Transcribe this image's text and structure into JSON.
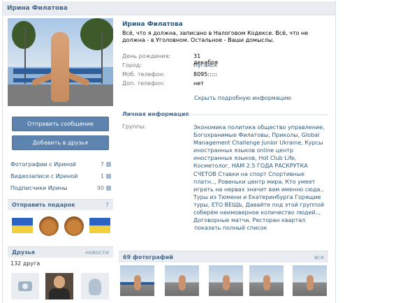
{
  "profile": {
    "header_name": "Ирина Филатова",
    "name": "Ирина Филатова",
    "status": "Всё, что я должна, записано в Налоговом Кодексе. Всё, что не должна - в Уголовном. Остальное - Ваши домыслы."
  },
  "actions": {
    "send_message": "Отправить сообщение",
    "add_friend": "Добавить в друзья"
  },
  "stats": [
    {
      "label": "Фотографии с Ириной",
      "count": "7"
    },
    {
      "label": "Видеозаписи с Ириной",
      "count": "1"
    },
    {
      "label": "Подписчики Ирины",
      "count": "90"
    }
  ],
  "gifts": {
    "title": "Отправить подарок",
    "count": "7"
  },
  "friends": {
    "title": "Друзья",
    "news_link": "новости",
    "count_text": "132 друга"
  },
  "info": {
    "birthday_label": "День рождения:",
    "birthday_value": "31 декабря",
    "city_label": "Город:",
    "city_value": "Луганск",
    "mobile_label": "Моб. телефон:",
    "mobile_value": "8095:::::",
    "phone_label": "Доп. телефон:",
    "phone_value": "нет",
    "show_more": "Скрыть подробную информацию"
  },
  "personal": {
    "title": "Личная информация",
    "groups_label": "Группы:",
    "groups_value": "Экономика политика общество управление, Богохранимые Филатовы, Приколы, Global Management Challenge Junior Ukraine, Курсы иностранных языков online центр иностранных языков, Hot Club Life, Косметолог, НАМ 2.5 ГОДА РАСКРУТКА СЧЕТОВ Ставки на спорт Спортивные платн.., Ровеньки центр мира, Кто умеет играть на нервах значит вам именно сюда., Туры из Тюмени и Екатеринбурга Горящие туры, ЕТО ВЕЩЬ, Давайте под этой группой соберём неимоверное количество людей.., Договорные матчи, Ресторан квартал",
    "show_full": "показать полный список"
  },
  "photos": {
    "title": "69 фотографий",
    "all_link": "все"
  }
}
